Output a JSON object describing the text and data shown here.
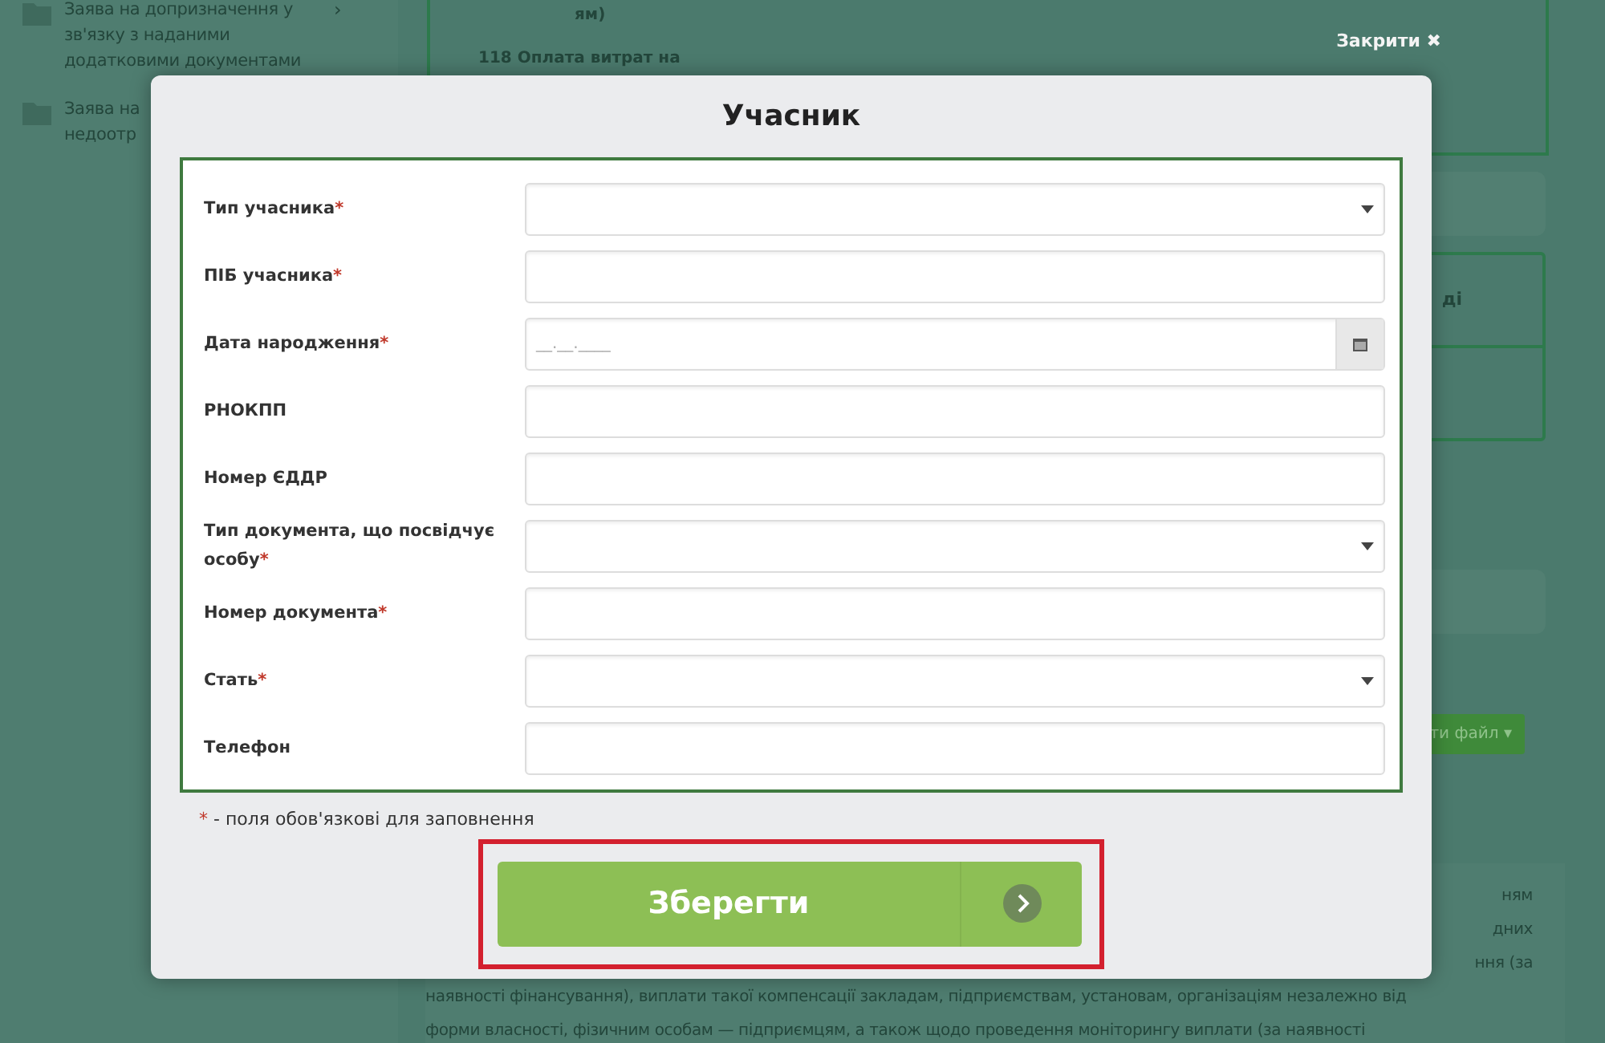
{
  "background": {
    "sidebar": [
      {
        "label": "Заява на допризначення у зв'язку з наданими додатковими документами",
        "chevron": "›"
      },
      {
        "label": "Заява на\nнедоотр"
      }
    ],
    "card_texts": [
      "ям)",
      "118 Оплата витрат на"
    ],
    "close": {
      "label": "Закрити",
      "icon": "✖"
    },
    "side_text": "ді",
    "file_button": {
      "label": "ти файл ▾"
    },
    "paragraph_right": [
      "ням",
      "дних",
      "ння (за"
    ],
    "paragraph": [
      "наявності фінансування), виплати такої компенсації закладам, підприємствам, установам, організаціям незалежно від",
      "форми власності, фізичним особам — підприємцям, а також щодо проведення моніторингу виплати (за наявності"
    ]
  },
  "modal": {
    "title": "Учасник",
    "required_mark": "*",
    "fields": [
      {
        "label": "Тип учасника",
        "required": true,
        "kind": "select"
      },
      {
        "label": "ПІБ учасника",
        "required": true,
        "kind": "text"
      },
      {
        "label": "Дата народження",
        "required": true,
        "kind": "date",
        "placeholder": "__.__.____"
      },
      {
        "label": "РНОКПП",
        "required": false,
        "kind": "text"
      },
      {
        "label": "Номер ЄДДР",
        "required": false,
        "kind": "text"
      },
      {
        "label": "Тип документа, що посвідчує особу",
        "required": true,
        "kind": "select"
      },
      {
        "label": "Номер документа",
        "required": true,
        "kind": "text"
      },
      {
        "label": "Стать",
        "required": true,
        "kind": "select"
      },
      {
        "label": "Телефон",
        "required": false,
        "kind": "text"
      }
    ],
    "footnote": "- поля обов'язкові для заповнення",
    "save_button": {
      "label": "Зберегти",
      "highlighted": true
    }
  }
}
